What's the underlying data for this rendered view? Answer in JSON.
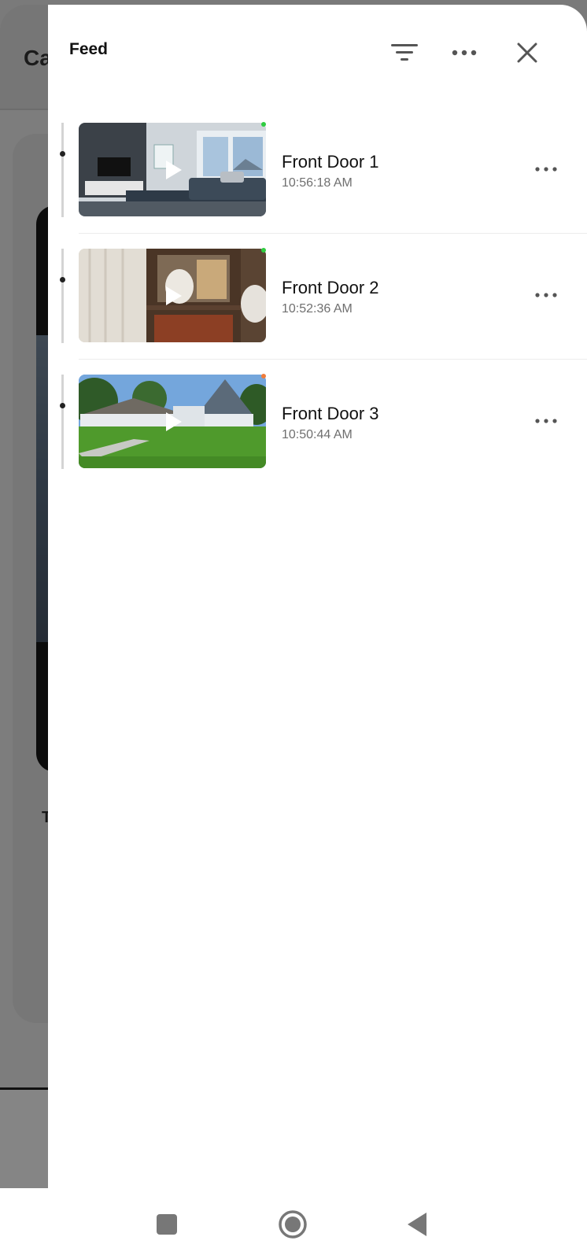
{
  "background_app": {
    "title": "Ca",
    "label": "T"
  },
  "drawer": {
    "title": "Feed",
    "icons": {
      "filter": "filter-icon",
      "more": "more-horizontal-icon",
      "close": "close-icon"
    }
  },
  "feed": {
    "items": [
      {
        "name": "Front Door 1",
        "time": "10:56:18 AM",
        "status_color": "#2ecc40",
        "thumbnail": "living-room"
      },
      {
        "name": "Front Door 2",
        "time": "10:52:36 AM",
        "status_color": "#2ecc40",
        "thumbnail": "interior-shelf"
      },
      {
        "name": "Front Door 3",
        "time": "10:50:44 AM",
        "status_color": "#f07c3a",
        "thumbnail": "house-exterior"
      }
    ]
  },
  "navbar": {
    "recents_icon": "recents-icon",
    "home_icon": "home-icon",
    "back_icon": "back-icon"
  }
}
